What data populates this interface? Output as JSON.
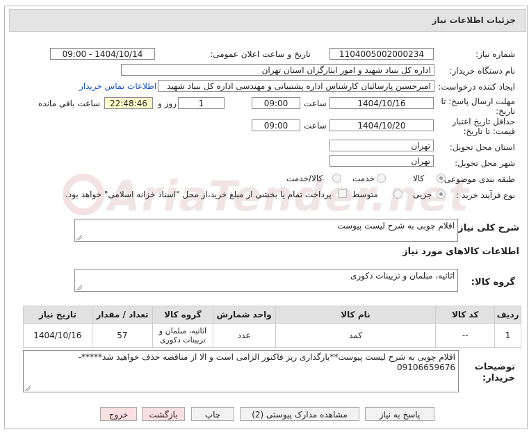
{
  "header": {
    "title": "جزئیات اطلاعات نیاز"
  },
  "watermark": {
    "text": "AriaTender.net"
  },
  "fields": {
    "need_number": {
      "label": "شماره نیاز:",
      "value": "1104005002000234"
    },
    "announce_datetime": {
      "label": "تاریخ و ساعت اعلان عمومی:",
      "value": "1404/10/14 - 09:00"
    },
    "buyer_org": {
      "label": "نام دستگاه خریدار:",
      "value": "اداره کل بنیاد شهید و امور ایثارگران استان تهران"
    },
    "requester": {
      "label": "ایجاد کننده درخواست:",
      "value": "امیرحسین پارسائیان کارشناس اداره پشتیبانی و مهندسی  اداره کل بنیاد شهید",
      "contact_link": "اطلاعات تماس خریدار"
    },
    "deadline": {
      "label_line1": "مهلت ارسال پاسخ: تا",
      "label_line2": "تاریخ:",
      "date": "1404/10/16",
      "time_label": "ساعت",
      "time": "09:00",
      "days": "1",
      "days_label": "روز و",
      "remaining": "22:48:46",
      "remaining_label": "ساعت باقی مانده"
    },
    "validity": {
      "label_line1": "حداقل تاریخ اعتبار",
      "label_line2": "قیمت: تا تاریخ:",
      "date": "1404/10/20",
      "time_label": "ساعت",
      "time": "09:00"
    },
    "province": {
      "label": "استان محل تحویل:",
      "value": "تهران"
    },
    "city": {
      "label": "شهر محل تحویل:",
      "value": "تهران"
    },
    "category": {
      "label": "طبقه بندی موضوعی:",
      "options": [
        "کالا",
        "خدمت",
        "کالا/خدمت"
      ],
      "selected": "کالا"
    },
    "process": {
      "label": "نوع فرآیند خرید :",
      "options": [
        "جزیی",
        "متوسط"
      ],
      "selected": "جزیی",
      "payment_note": "پرداخت تمام یا بخشی از مبلغ خرید،از محل \"اسناد خزانه اسلامی\" خواهد بود."
    },
    "general_desc": {
      "label": "شرح کلی نیاز:",
      "value": "اقلام چوبی به شرح لیست پیوست"
    }
  },
  "goods": {
    "section_title": "اطلاعات کالاهای مورد نیاز",
    "group_label": "گروه کالا:",
    "group_value": "اثاثیه، مبلمان و تزیینات دکوری",
    "table": {
      "headers": [
        "ردیف",
        "کد کالا",
        "نام کالا",
        "واحد شمارش",
        "گروه کالا",
        "تعداد / مقدار",
        "تاریخ نیاز"
      ],
      "rows": [
        [
          "1",
          "--",
          "کمد",
          "عدد",
          "اثاثیه، مبلمان و تزیینات دکوری",
          "57",
          "1404/10/16"
        ]
      ]
    }
  },
  "buyer_notes": {
    "label_line1": "توضیحات",
    "label_line2": "خریدار:",
    "line1": "اقلام چوبی به شرح لیست پیوست**بارگذاری ریز فاکتور الزامی است و الا از مناقصه حذف خواهید شد*****-",
    "line2": "09106659676"
  },
  "buttons": {
    "reply": "پاسخ به نیاز",
    "docs": "مشاهده مدارک پیوستی (2)",
    "print": "چاپ",
    "back": "بازگشت",
    "exit": "خروج"
  }
}
